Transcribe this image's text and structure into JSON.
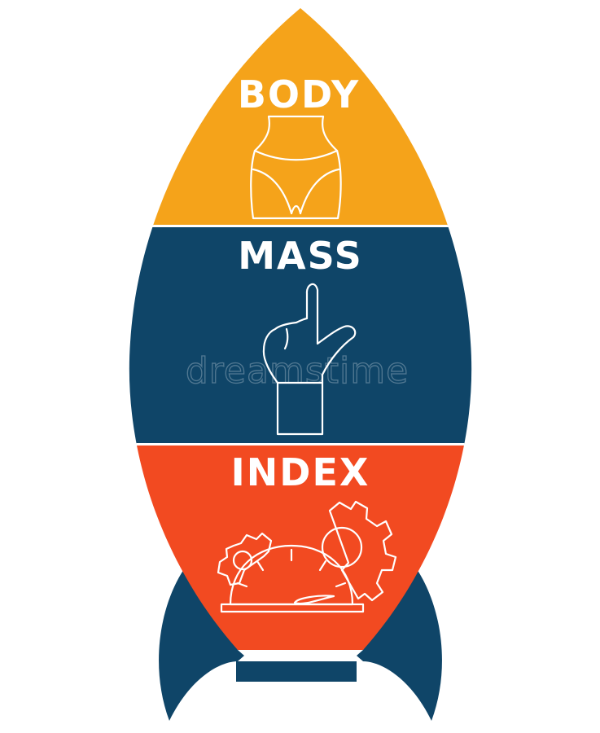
{
  "labels": {
    "word1": "BODY",
    "word2": "MASS",
    "word3": "INDEX"
  },
  "watermark": "dreamstime",
  "colors": {
    "orange": "#f5a31a",
    "navy": "#0f4568",
    "red": "#f24a21",
    "white": "#ffffff"
  },
  "icons": {
    "section1": "body-hips-icon",
    "section2": "pointing-finger-icon",
    "section3": "speedometer-gears-icon"
  }
}
